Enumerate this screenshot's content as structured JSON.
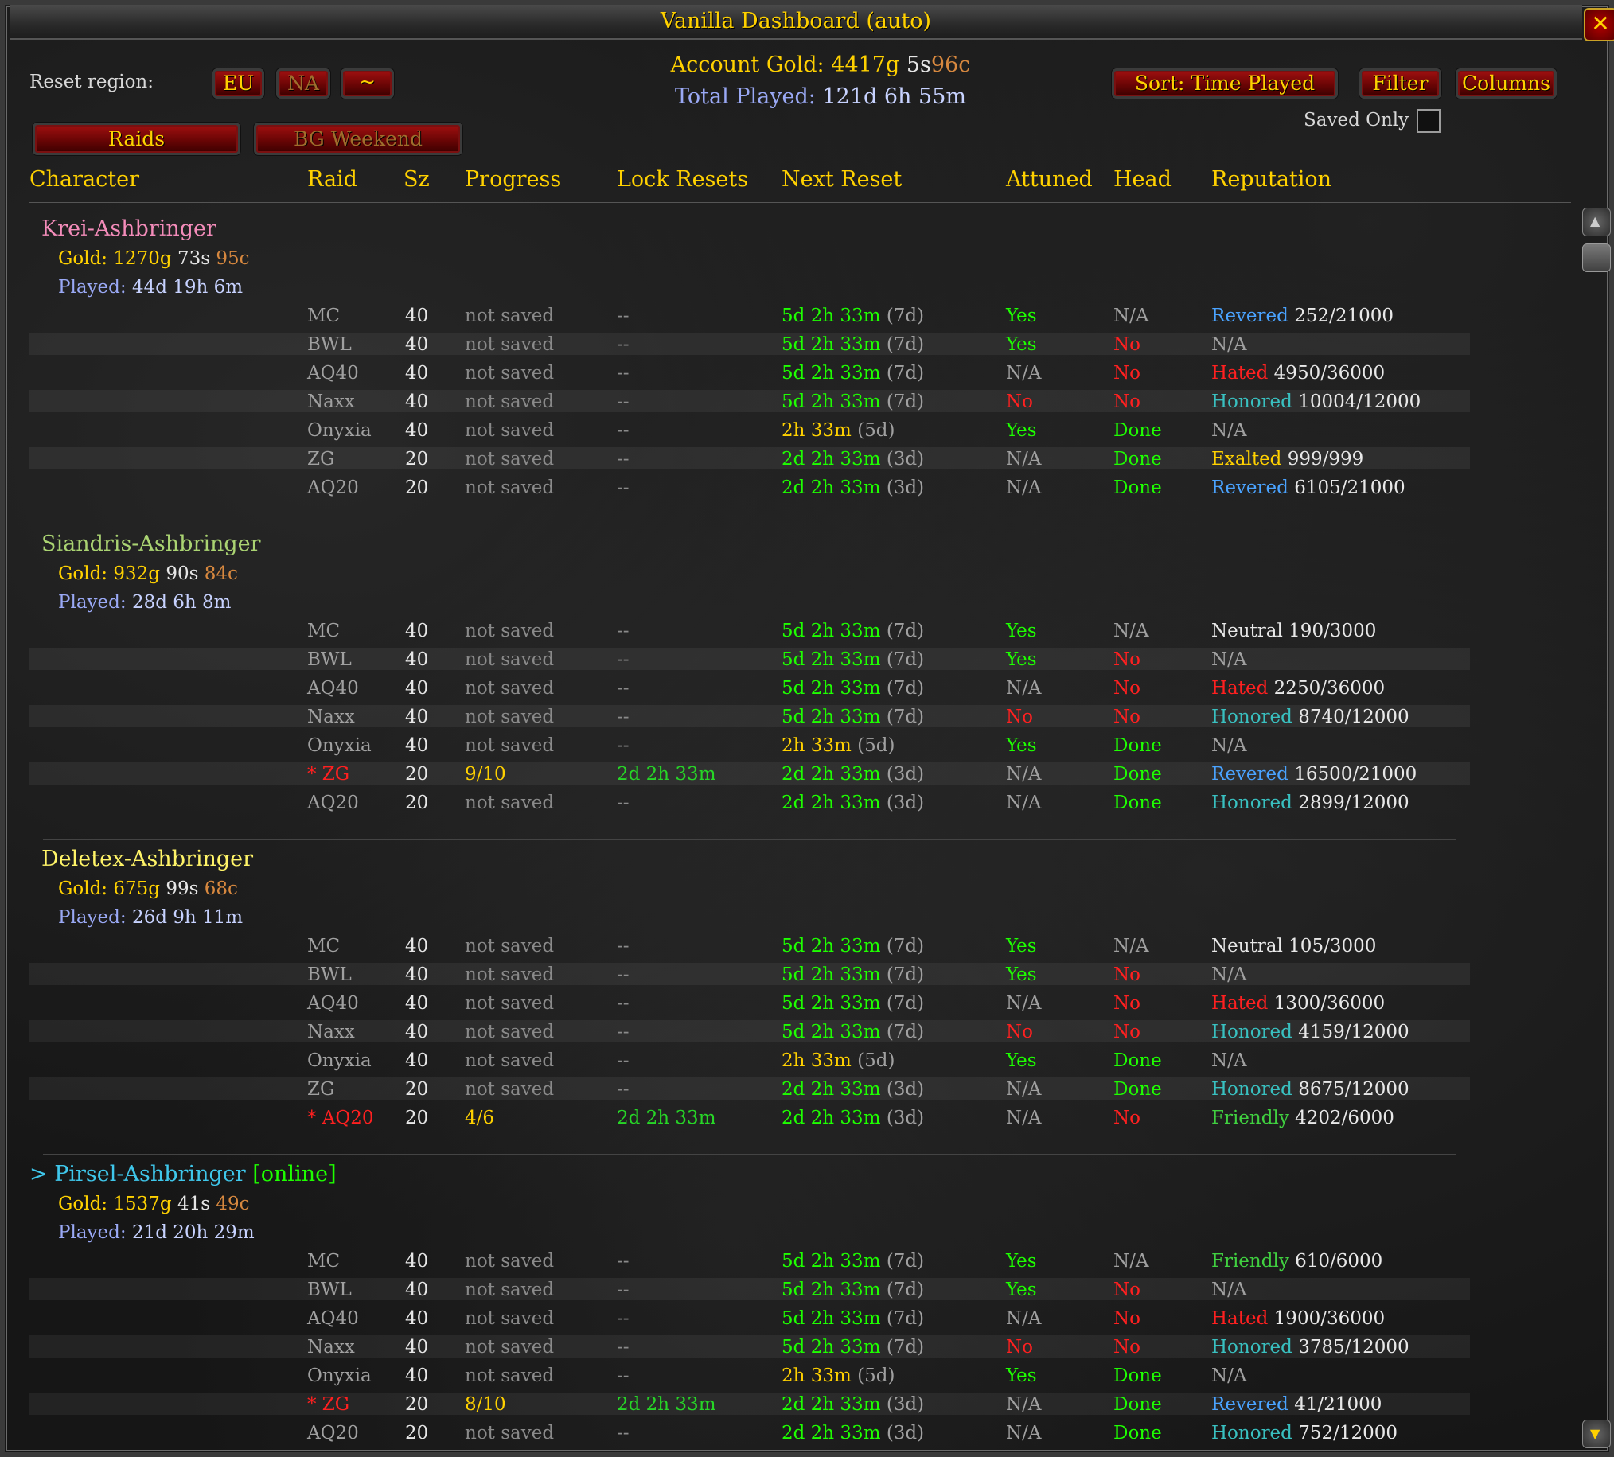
{
  "window": {
    "title": "Vanilla Dashboard  (auto)",
    "close_icon": "close-icon"
  },
  "toolbar": {
    "reset_region_label": "Reset region:",
    "region_eu": "EU",
    "region_na": "NA",
    "region_tilde": "~",
    "account_gold_label": "Account Gold:",
    "account_gold_g": "4417g",
    "account_gold_s": "5s",
    "account_gold_c": "96c",
    "total_played_label": "Total Played:",
    "total_played_value": "121d 6h 55m",
    "sort_label": "Sort: Time Played",
    "filter_label": "Filter",
    "columns_label": "Columns",
    "saved_only_label": "Saved Only",
    "saved_only_checked": false,
    "tab_raids": "Raids",
    "tab_bg": "BG Weekend"
  },
  "columns": [
    "Character",
    "Raid",
    "Sz",
    "Progress",
    "Lock Resets",
    "Next Reset",
    "Attuned",
    "Head",
    "Reputation"
  ],
  "characters": [
    {
      "name": "Krei-Ashbringer",
      "name_color": "#f48cba",
      "prefix": "",
      "status": "",
      "gold_label": "Gold:",
      "g": "1270g",
      "s": "73s",
      "c": "95c",
      "played_label": "Played:",
      "played": "44d 19h 6m",
      "raids": [
        {
          "raid": "MC",
          "sz": "40",
          "progress": "not saved",
          "lock": "--",
          "next": "5d 2h 33m",
          "next_paren": "(7d)",
          "next_color": "green",
          "attuned": "Yes",
          "attuned_color": "green",
          "head": "N/A",
          "head_color": "gray",
          "rep_label": "Revered",
          "rep_color": "revered",
          "rep_value": "252/21000",
          "saved": false
        },
        {
          "raid": "BWL",
          "sz": "40",
          "progress": "not saved",
          "lock": "--",
          "next": "5d 2h 33m",
          "next_paren": "(7d)",
          "next_color": "green",
          "attuned": "Yes",
          "attuned_color": "green",
          "head": "No",
          "head_color": "red",
          "rep_label": "N/A",
          "rep_color": "gray",
          "rep_value": "",
          "saved": false
        },
        {
          "raid": "AQ40",
          "sz": "40",
          "progress": "not saved",
          "lock": "--",
          "next": "5d 2h 33m",
          "next_paren": "(7d)",
          "next_color": "green",
          "attuned": "N/A",
          "attuned_color": "gray",
          "head": "No",
          "head_color": "red",
          "rep_label": "Hated",
          "rep_color": "hated",
          "rep_value": "4950/36000",
          "saved": false
        },
        {
          "raid": "Naxx",
          "sz": "40",
          "progress": "not saved",
          "lock": "--",
          "next": "5d 2h 33m",
          "next_paren": "(7d)",
          "next_color": "green",
          "attuned": "No",
          "attuned_color": "red",
          "head": "No",
          "head_color": "red",
          "rep_label": "Honored",
          "rep_color": "honored",
          "rep_value": "10004/12000",
          "saved": false
        },
        {
          "raid": "Onyxia",
          "sz": "40",
          "progress": "not saved",
          "lock": "--",
          "next": "2h 33m",
          "next_paren": "(5d)",
          "next_color": "yel",
          "attuned": "Yes",
          "attuned_color": "green",
          "head": "Done",
          "head_color": "green",
          "rep_label": "N/A",
          "rep_color": "gray",
          "rep_value": "",
          "saved": false
        },
        {
          "raid": "ZG",
          "sz": "20",
          "progress": "not saved",
          "lock": "--",
          "next": "2d 2h 33m",
          "next_paren": "(3d)",
          "next_color": "green",
          "attuned": "N/A",
          "attuned_color": "gray",
          "head": "Done",
          "head_color": "green",
          "rep_label": "Exalted",
          "rep_color": "exalted",
          "rep_value": "999/999",
          "saved": false
        },
        {
          "raid": "AQ20",
          "sz": "20",
          "progress": "not saved",
          "lock": "--",
          "next": "2d 2h 33m",
          "next_paren": "(3d)",
          "next_color": "green",
          "attuned": "N/A",
          "attuned_color": "gray",
          "head": "Done",
          "head_color": "green",
          "rep_label": "Revered",
          "rep_color": "revered",
          "rep_value": "6105/21000",
          "saved": false
        }
      ]
    },
    {
      "name": "Siandris-Ashbringer",
      "name_color": "#aad372",
      "prefix": "",
      "status": "",
      "gold_label": "Gold:",
      "g": "932g",
      "s": "90s",
      "c": "84c",
      "played_label": "Played:",
      "played": "28d 6h 8m",
      "raids": [
        {
          "raid": "MC",
          "sz": "40",
          "progress": "not saved",
          "lock": "--",
          "next": "5d 2h 33m",
          "next_paren": "(7d)",
          "next_color": "green",
          "attuned": "Yes",
          "attuned_color": "green",
          "head": "N/A",
          "head_color": "gray",
          "rep_label": "Neutral",
          "rep_color": "neutral",
          "rep_value": "190/3000",
          "saved": false
        },
        {
          "raid": "BWL",
          "sz": "40",
          "progress": "not saved",
          "lock": "--",
          "next": "5d 2h 33m",
          "next_paren": "(7d)",
          "next_color": "green",
          "attuned": "Yes",
          "attuned_color": "green",
          "head": "No",
          "head_color": "red",
          "rep_label": "N/A",
          "rep_color": "gray",
          "rep_value": "",
          "saved": false
        },
        {
          "raid": "AQ40",
          "sz": "40",
          "progress": "not saved",
          "lock": "--",
          "next": "5d 2h 33m",
          "next_paren": "(7d)",
          "next_color": "green",
          "attuned": "N/A",
          "attuned_color": "gray",
          "head": "No",
          "head_color": "red",
          "rep_label": "Hated",
          "rep_color": "hated",
          "rep_value": "2250/36000",
          "saved": false
        },
        {
          "raid": "Naxx",
          "sz": "40",
          "progress": "not saved",
          "lock": "--",
          "next": "5d 2h 33m",
          "next_paren": "(7d)",
          "next_color": "green",
          "attuned": "No",
          "attuned_color": "red",
          "head": "No",
          "head_color": "red",
          "rep_label": "Honored",
          "rep_color": "honored",
          "rep_value": "8740/12000",
          "saved": false
        },
        {
          "raid": "Onyxia",
          "sz": "40",
          "progress": "not saved",
          "lock": "--",
          "next": "2h 33m",
          "next_paren": "(5d)",
          "next_color": "yel",
          "attuned": "Yes",
          "attuned_color": "green",
          "head": "Done",
          "head_color": "green",
          "rep_label": "N/A",
          "rep_color": "gray",
          "rep_value": "",
          "saved": false
        },
        {
          "raid": "* ZG",
          "sz": "20",
          "progress": "9/10",
          "lock": "2d 2h 33m",
          "next": "2d 2h 33m",
          "next_paren": "(3d)",
          "next_color": "green",
          "attuned": "N/A",
          "attuned_color": "gray",
          "head": "Done",
          "head_color": "green",
          "rep_label": "Revered",
          "rep_color": "revered",
          "rep_value": "16500/21000",
          "saved": true
        },
        {
          "raid": "AQ20",
          "sz": "20",
          "progress": "not saved",
          "lock": "--",
          "next": "2d 2h 33m",
          "next_paren": "(3d)",
          "next_color": "green",
          "attuned": "N/A",
          "attuned_color": "gray",
          "head": "Done",
          "head_color": "green",
          "rep_label": "Honored",
          "rep_color": "honored",
          "rep_value": "2899/12000",
          "saved": false
        }
      ]
    },
    {
      "name": "Deletex-Ashbringer",
      "name_color": "#fff468",
      "prefix": "",
      "status": "",
      "gold_label": "Gold:",
      "g": "675g",
      "s": "99s",
      "c": "68c",
      "played_label": "Played:",
      "played": "26d 9h 11m",
      "raids": [
        {
          "raid": "MC",
          "sz": "40",
          "progress": "not saved",
          "lock": "--",
          "next": "5d 2h 33m",
          "next_paren": "(7d)",
          "next_color": "green",
          "attuned": "Yes",
          "attuned_color": "green",
          "head": "N/A",
          "head_color": "gray",
          "rep_label": "Neutral",
          "rep_color": "neutral",
          "rep_value": "105/3000",
          "saved": false
        },
        {
          "raid": "BWL",
          "sz": "40",
          "progress": "not saved",
          "lock": "--",
          "next": "5d 2h 33m",
          "next_paren": "(7d)",
          "next_color": "green",
          "attuned": "Yes",
          "attuned_color": "green",
          "head": "No",
          "head_color": "red",
          "rep_label": "N/A",
          "rep_color": "gray",
          "rep_value": "",
          "saved": false
        },
        {
          "raid": "AQ40",
          "sz": "40",
          "progress": "not saved",
          "lock": "--",
          "next": "5d 2h 33m",
          "next_paren": "(7d)",
          "next_color": "green",
          "attuned": "N/A",
          "attuned_color": "gray",
          "head": "No",
          "head_color": "red",
          "rep_label": "Hated",
          "rep_color": "hated",
          "rep_value": "1300/36000",
          "saved": false
        },
        {
          "raid": "Naxx",
          "sz": "40",
          "progress": "not saved",
          "lock": "--",
          "next": "5d 2h 33m",
          "next_paren": "(7d)",
          "next_color": "green",
          "attuned": "No",
          "attuned_color": "red",
          "head": "No",
          "head_color": "red",
          "rep_label": "Honored",
          "rep_color": "honored",
          "rep_value": "4159/12000",
          "saved": false
        },
        {
          "raid": "Onyxia",
          "sz": "40",
          "progress": "not saved",
          "lock": "--",
          "next": "2h 33m",
          "next_paren": "(5d)",
          "next_color": "yel",
          "attuned": "Yes",
          "attuned_color": "green",
          "head": "Done",
          "head_color": "green",
          "rep_label": "N/A",
          "rep_color": "gray",
          "rep_value": "",
          "saved": false
        },
        {
          "raid": "ZG",
          "sz": "20",
          "progress": "not saved",
          "lock": "--",
          "next": "2d 2h 33m",
          "next_paren": "(3d)",
          "next_color": "green",
          "attuned": "N/A",
          "attuned_color": "gray",
          "head": "Done",
          "head_color": "green",
          "rep_label": "Honored",
          "rep_color": "honored",
          "rep_value": "8675/12000",
          "saved": false
        },
        {
          "raid": "* AQ20",
          "sz": "20",
          "progress": "4/6",
          "lock": "2d 2h 33m",
          "next": "2d 2h 33m",
          "next_paren": "(3d)",
          "next_color": "green",
          "attuned": "N/A",
          "attuned_color": "gray",
          "head": "No",
          "head_color": "red",
          "rep_label": "Friendly",
          "rep_color": "friendly",
          "rep_value": "4202/6000",
          "saved": true
        }
      ]
    },
    {
      "name": "Pirsel-Ashbringer",
      "name_color": "#3fc7eb",
      "prefix": "> ",
      "status": "[online]",
      "gold_label": "Gold:",
      "g": "1537g",
      "s": "41s",
      "c": "49c",
      "played_label": "Played:",
      "played": "21d 20h 29m",
      "raids": [
        {
          "raid": "MC",
          "sz": "40",
          "progress": "not saved",
          "lock": "--",
          "next": "5d 2h 33m",
          "next_paren": "(7d)",
          "next_color": "green",
          "attuned": "Yes",
          "attuned_color": "green",
          "head": "N/A",
          "head_color": "gray",
          "rep_label": "Friendly",
          "rep_color": "friendly",
          "rep_value": "610/6000",
          "saved": false
        },
        {
          "raid": "BWL",
          "sz": "40",
          "progress": "not saved",
          "lock": "--",
          "next": "5d 2h 33m",
          "next_paren": "(7d)",
          "next_color": "green",
          "attuned": "Yes",
          "attuned_color": "green",
          "head": "No",
          "head_color": "red",
          "rep_label": "N/A",
          "rep_color": "gray",
          "rep_value": "",
          "saved": false
        },
        {
          "raid": "AQ40",
          "sz": "40",
          "progress": "not saved",
          "lock": "--",
          "next": "5d 2h 33m",
          "next_paren": "(7d)",
          "next_color": "green",
          "attuned": "N/A",
          "attuned_color": "gray",
          "head": "No",
          "head_color": "red",
          "rep_label": "Hated",
          "rep_color": "hated",
          "rep_value": "1900/36000",
          "saved": false
        },
        {
          "raid": "Naxx",
          "sz": "40",
          "progress": "not saved",
          "lock": "--",
          "next": "5d 2h 33m",
          "next_paren": "(7d)",
          "next_color": "green",
          "attuned": "No",
          "attuned_color": "red",
          "head": "No",
          "head_color": "red",
          "rep_label": "Honored",
          "rep_color": "honored",
          "rep_value": "3785/12000",
          "saved": false
        },
        {
          "raid": "Onyxia",
          "sz": "40",
          "progress": "not saved",
          "lock": "--",
          "next": "2h 33m",
          "next_paren": "(5d)",
          "next_color": "yel",
          "attuned": "Yes",
          "attuned_color": "green",
          "head": "Done",
          "head_color": "green",
          "rep_label": "N/A",
          "rep_color": "gray",
          "rep_value": "",
          "saved": false
        },
        {
          "raid": "* ZG",
          "sz": "20",
          "progress": "8/10",
          "lock": "2d 2h 33m",
          "next": "2d 2h 33m",
          "next_paren": "(3d)",
          "next_color": "green",
          "attuned": "N/A",
          "attuned_color": "gray",
          "head": "Done",
          "head_color": "green",
          "rep_label": "Revered",
          "rep_color": "revered",
          "rep_value": "41/21000",
          "saved": true
        },
        {
          "raid": "AQ20",
          "sz": "20",
          "progress": "not saved",
          "lock": "--",
          "next": "2d 2h 33m",
          "next_paren": "(3d)",
          "next_color": "green",
          "attuned": "N/A",
          "attuned_color": "gray",
          "head": "Done",
          "head_color": "green",
          "rep_label": "Honored",
          "rep_color": "honored",
          "rep_value": "752/12000",
          "saved": false
        }
      ]
    }
  ]
}
